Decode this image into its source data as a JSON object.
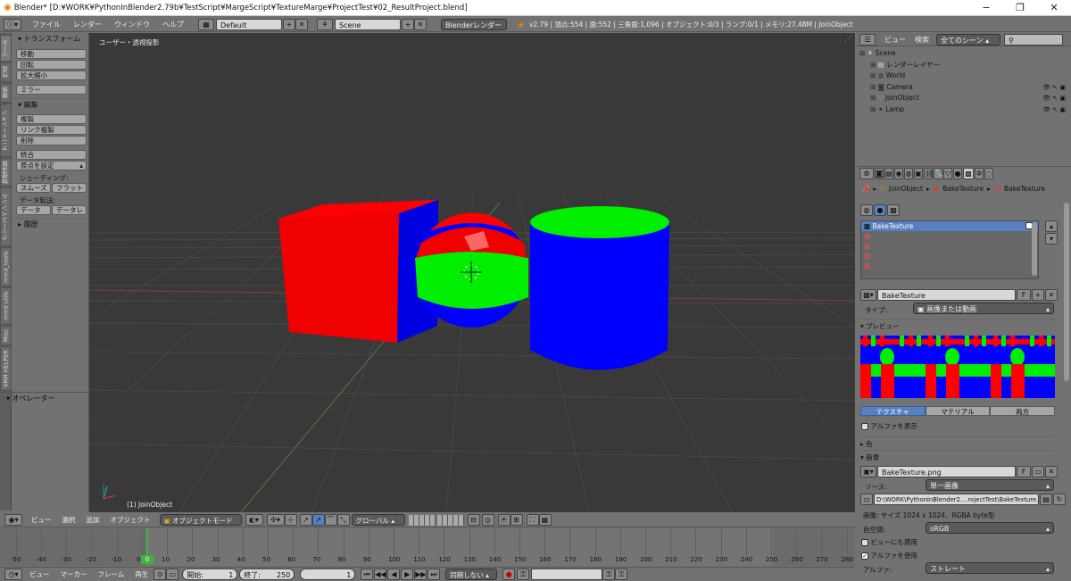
{
  "window": {
    "title": "Blender* [D:¥WORK¥PythonInBlender2.79b¥TestScript¥MargeScript¥TextureMarge¥ProjectTest¥02_ResultProject.blend]",
    "minimize": "−",
    "maximize": "❐",
    "close": "✕"
  },
  "topbar": {
    "menus": [
      "ファイル",
      "レンダー",
      "ウィンドウ",
      "ヘルプ"
    ],
    "screen_layout": "Default",
    "scene": "Scene",
    "render_engine": "Blenderレンダー",
    "stats": "v2.79 | 頂点:554 | 面:552 | 三角面:1,096 | オブジェクト:0/3 | ランプ:0/1 | メモリ:27.48M | JoinObject"
  },
  "vertical_tabs": [
    "ツール",
    "作成",
    "関係",
    "アニメーション",
    "物理演算",
    "グリースペンシル",
    "mmd_tools",
    "mmd utils",
    "Misc",
    "VRM HELPER"
  ],
  "tool_shelf": {
    "transform_header": "トランスフォーム",
    "transform_buttons": [
      "移動",
      "回転",
      "拡大縮小"
    ],
    "mirror": "ミラー",
    "edit_header": "編集",
    "edit_buttons": [
      "複製",
      "リンク複製",
      "削除"
    ],
    "join": "統合",
    "origin": "原点を設定",
    "shading_label": "シェーディング:",
    "smooth": "スムーズ",
    "flat": "フラット",
    "data_transfer_label": "データ転送:",
    "data": "データ",
    "data_layout": "データレ",
    "history": "履歴",
    "operator": "オペレーター"
  },
  "viewport": {
    "view_name": "ユーザー・透視投影",
    "object_label": "(1) JoinObject"
  },
  "viewport_header": {
    "menus": [
      "ビュー",
      "選択",
      "追加",
      "オブジェクト"
    ],
    "mode": "オブジェクトモード",
    "orientation": "グローバル"
  },
  "outliner": {
    "menus": [
      "ビュー",
      "検索"
    ],
    "filter": "全てのシーン",
    "rows": [
      {
        "name": "Scene",
        "indent": 0
      },
      {
        "name": "レンダーレイヤー",
        "indent": 1
      },
      {
        "name": "World",
        "indent": 1
      },
      {
        "name": "Camera",
        "indent": 1
      },
      {
        "name": "JoinObject",
        "indent": 1
      },
      {
        "name": "Lamp",
        "indent": 1
      }
    ]
  },
  "properties": {
    "breadcrumb": [
      "JoinObject",
      "BakeTexture",
      "BakeTexture"
    ],
    "texture_slot_selected": "BakeTexture",
    "texture_name": "BakeTexture",
    "texture_f": "F",
    "type_label": "タイプ:",
    "type_value": "画像または動画",
    "preview_header": "プレビュー",
    "tabs": [
      "テクスチャ",
      "マテリアル",
      "両方"
    ],
    "show_alpha": "アルファを表示",
    "color_header": "色",
    "image_header": "画像",
    "image_name": "BakeTexture.png",
    "image_f": "F",
    "source_label": "ソース:",
    "source_value": "単一画像",
    "filepath": "D:\\WORK\\PythonInBlender2....rojectTest\\BakeTexture.png",
    "image_info": "画像: サイズ 1024 x 1024、RGBA byte型",
    "colorspace_label": "色空間:",
    "colorspace_value": "sRGB",
    "view_as_render": "ビューにも適用",
    "use_alpha": "アルファを使用",
    "alpha_label": "アルファ:",
    "alpha_value": "ストレート"
  },
  "timeline": {
    "ruler": [
      "-50",
      "-40",
      "-30",
      "-20",
      "-10",
      "0",
      "10",
      "20",
      "30",
      "40",
      "50",
      "60",
      "70",
      "80",
      "90",
      "100",
      "110",
      "120",
      "130",
      "140",
      "150",
      "160",
      "170",
      "180",
      "190",
      "200",
      "210",
      "220",
      "230",
      "240",
      "250",
      "260",
      "270",
      "280"
    ],
    "current_frame_marker": "0",
    "menus": [
      "ビュー",
      "マーカー",
      "フレーム",
      "再生"
    ],
    "start_label": "開始:",
    "start_value": "1",
    "end_label": "終了:",
    "end_value": "250",
    "current_frame": "1",
    "sync": "同期しない"
  },
  "colors": {
    "cube": "#ff0000",
    "sphere_band": "#00ff00",
    "cylinder": "#0000ff",
    "selected": "#5680c2"
  }
}
